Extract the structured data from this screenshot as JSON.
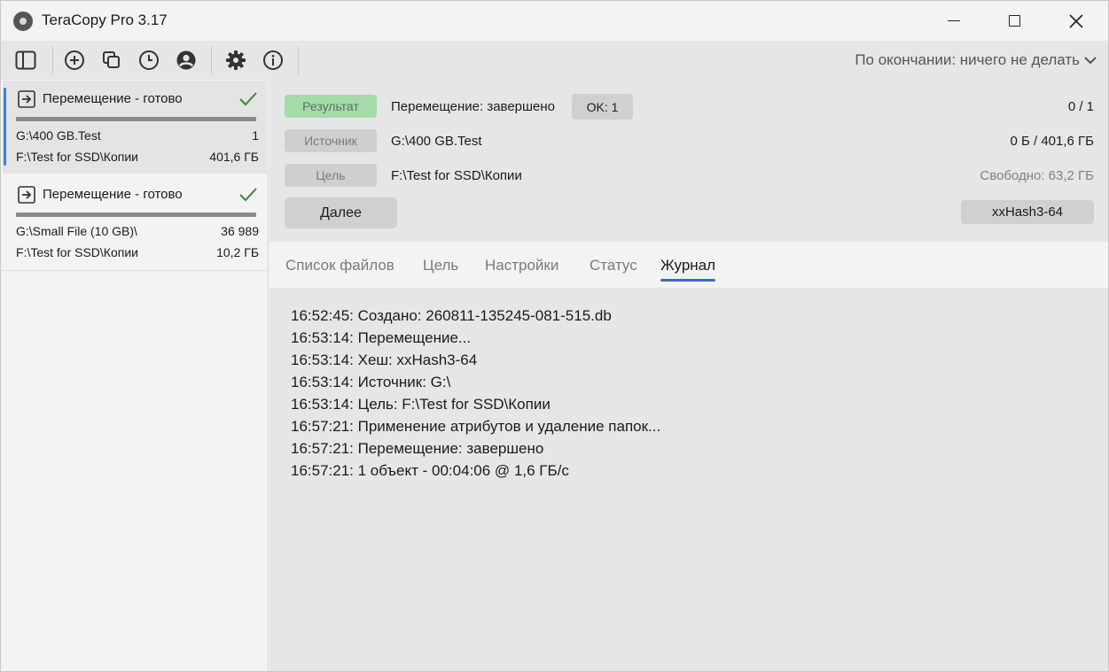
{
  "window": {
    "title": "TeraCopy Pro 3.17"
  },
  "toolbar": {
    "after_finish": "По окончании: ничего не делать"
  },
  "jobs": [
    {
      "title": "Перемещение - готово",
      "source": "G:\\400 GB.Test",
      "count": "1",
      "target": "F:\\Test for SSD\\Копии",
      "size": "401,6 ГБ"
    },
    {
      "title": "Перемещение - готово",
      "source": "G:\\Small File (10 GB)\\",
      "count": "36 989",
      "target": "F:\\Test for SSD\\Копии",
      "size": "10,2 ГБ"
    }
  ],
  "details": {
    "result_label": "Результат",
    "result_value": "Перемещение: завершено",
    "ok_badge": "OK: 1",
    "progress_count": "0 / 1",
    "source_label": "Источник",
    "source_value": "G:\\400 GB.Test",
    "source_size": "0 Б / 401,6 ГБ",
    "target_label": "Цель",
    "target_value": "F:\\Test for SSD\\Копии",
    "free_space": "Свободно: 63,2 ГБ",
    "next_button": "Далее",
    "hash_button": "xxHash3-64"
  },
  "tabs": [
    {
      "label": "Список файлов"
    },
    {
      "label": "Цель"
    },
    {
      "label": "Настройки"
    },
    {
      "label": "Статус"
    },
    {
      "label": "Журнал"
    }
  ],
  "log": [
    "16:52:45: Создано: 260811-135245-081-515.db",
    "16:53:14: Перемещение...",
    "16:53:14: Хеш: xxHash3-64",
    "16:53:14: Источник: G:\\",
    "16:53:14: Цель: F:\\Test for SSD\\Копии",
    "16:57:21: Применение атрибутов и удаление папок...",
    "16:57:21: Перемещение: завершено",
    "16:57:21: 1 объект - 00:04:06 @ 1,6 ГБ/с"
  ],
  "colors": {
    "accent": "#3b82d6",
    "result_green": "#a4dba9",
    "check_green": "#2e8b3a",
    "tab_underline": "#2f6fc4"
  }
}
